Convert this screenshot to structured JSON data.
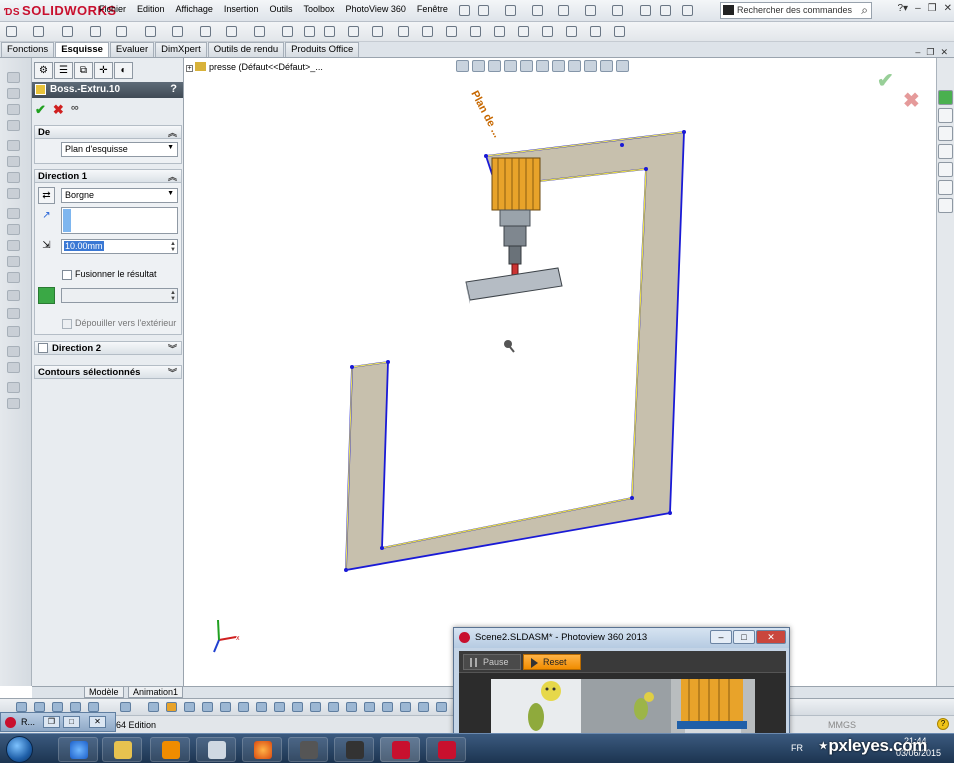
{
  "app": {
    "logo": "SOLIDWORKS",
    "menus": [
      "Fichier",
      "Edition",
      "Affichage",
      "Insertion",
      "Outils",
      "Toolbox",
      "PhotoView 360",
      "Fenêtre"
    ],
    "search_placeholder": "Rechercher des commandes"
  },
  "command_tabs": [
    "Fonctions",
    "Esquisse",
    "Evaluer",
    "DimXpert",
    "Outils de rendu",
    "Produits Office"
  ],
  "property_manager": {
    "title": "Boss.-Extru.10",
    "help": "?",
    "from": {
      "label": "De",
      "value": "Plan d'esquisse"
    },
    "direction1": {
      "label": "Direction 1",
      "end_condition": "Borgne",
      "depth": "10.00mm",
      "merge_result": "Fusionner le résultat",
      "draft_outward": "Dépouiller vers l'extérieur"
    },
    "direction2": {
      "label": "Direction 2"
    },
    "selected_contours": {
      "label": "Contours sélectionnés"
    }
  },
  "tree_root": "presse  (Défaut<<Défaut>_...",
  "plane_label": "Plan de ...",
  "bottom_tabs": [
    "Modèle",
    "Animation1"
  ],
  "status": {
    "edition": "64 Edition",
    "units": "MMGS"
  },
  "minimized_window": {
    "title": "R..."
  },
  "photoview": {
    "title": "Scene2.SLDASM* - Photoview 360 2013",
    "pause": "Pause",
    "reset": "Reset"
  },
  "taskbar": {
    "lang": "FR",
    "time": "21:44",
    "date": "03/06/2015"
  },
  "watermark": "pxleyes.com",
  "colors": {
    "sketch_blue": "#1a1ad6",
    "profile_fill": "#c7c0ad",
    "tool_orange": "#e8a32a",
    "accent_orange": "#f08c00"
  }
}
